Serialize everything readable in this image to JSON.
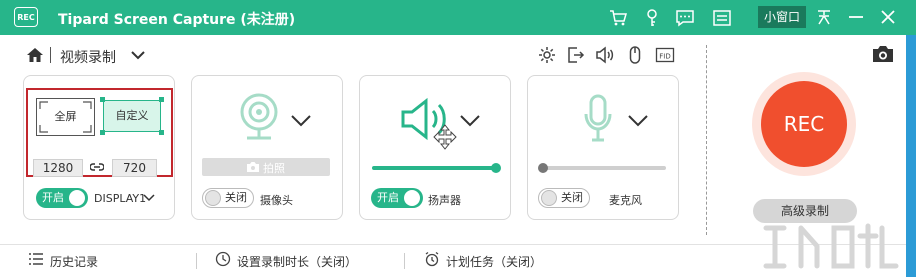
{
  "app": {
    "logo_text": "REC",
    "title": "Tipard Screen Capture (未注册)",
    "mini_window_label": "小窗口"
  },
  "toolbar": {
    "mode_label": "视频录制",
    "fps_label": "FID"
  },
  "display": {
    "full_screen_label": "全屏",
    "custom_label": "自定义",
    "width": "1280",
    "height": "720",
    "toggle_label": "开启",
    "source_label": "DISPLAY1"
  },
  "webcam": {
    "snapshot_label": "拍照",
    "toggle_label": "关闭",
    "device_label": "摄像头"
  },
  "speaker": {
    "toggle_label": "开启",
    "device_label": "扬声器",
    "volume": 1.0
  },
  "microphone": {
    "toggle_label": "关闭",
    "device_label": "麦克风",
    "volume": 0.0
  },
  "record": {
    "rec_label": "REC",
    "advanced_label": "高级录制"
  },
  "footer": {
    "history_label": "历史记录",
    "duration_label": "设置录制时长（关闭）",
    "schedule_label": "计划任务（关闭）"
  },
  "colors": {
    "accent": "#27b58a",
    "rec": "#f04f2e",
    "highlight_border": "#c2272d"
  }
}
